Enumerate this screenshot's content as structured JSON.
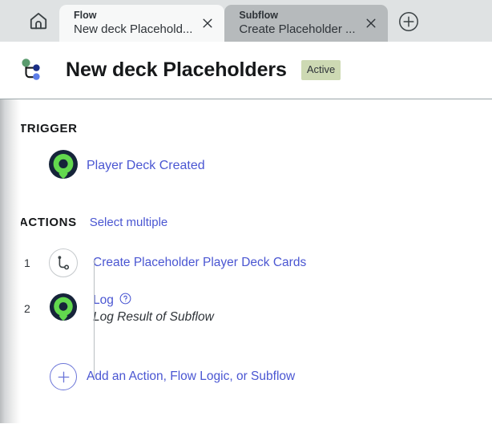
{
  "tabbar": {
    "home_icon": "home-icon",
    "new_tab_icon": "plus-circle-icon",
    "tabs": [
      {
        "kind": "Flow",
        "title": "New deck Placehold...",
        "close_icon": "close-icon",
        "active": true
      },
      {
        "kind": "Subflow",
        "title": "Create Placeholder ...",
        "close_icon": "close-icon",
        "active": false
      }
    ]
  },
  "header": {
    "logo_icon": "flow-designer-logo-icon",
    "title": "New deck Placeholders",
    "status": "Active",
    "status_color": "#cdd9b3"
  },
  "trigger": {
    "section_label": "TRIGGER",
    "icon": "servicenow-mark-icon",
    "label": "Player Deck Created"
  },
  "actions": {
    "section_label": "ACTIONS",
    "select_multiple_label": "Select multiple",
    "items": [
      {
        "index": "1",
        "icon": "subflow-icon",
        "label": "Create Placeholder Player Deck Cards",
        "subtext": "",
        "help_icon": ""
      },
      {
        "index": "2",
        "icon": "servicenow-mark-icon",
        "label": "Log",
        "help_icon": "help-circle-icon",
        "subtext": "Log Result of Subflow"
      }
    ],
    "add_action": {
      "icon": "plus-circle-icon",
      "label": "Add an Action, Flow Logic, or Subflow"
    }
  },
  "colors": {
    "link": "#4a56d2",
    "tabbar_bg": "#dfe2e3",
    "active_tab_bg": "#f7f8f8",
    "inactive_tab_bg": "#b6babc",
    "brand_green": "#62d84e",
    "brand_navy": "#16243a"
  }
}
